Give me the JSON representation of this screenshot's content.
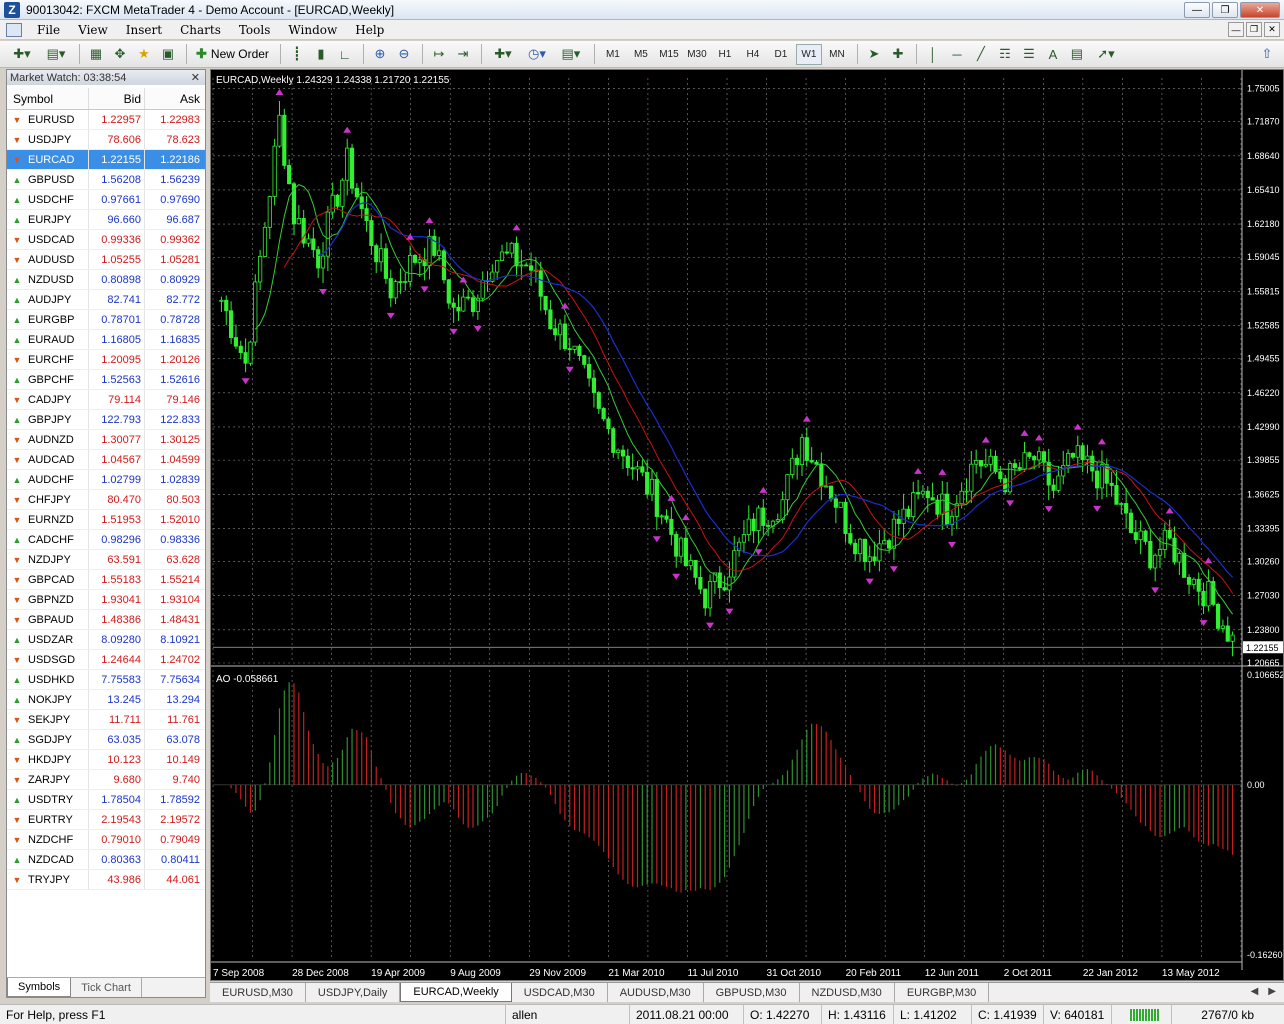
{
  "window": {
    "title": "90013042: FXCM MetaTrader 4 - Demo Account - [EURCAD,Weekly]",
    "app_icon": "Z"
  },
  "menu": [
    "File",
    "View",
    "Insert",
    "Charts",
    "Tools",
    "Window",
    "Help"
  ],
  "toolbar": {
    "new_order_label": "New Order",
    "timeframes": [
      "M1",
      "M5",
      "M15",
      "M30",
      "H1",
      "H4",
      "D1",
      "W1",
      "MN"
    ],
    "active_timeframe": "W1"
  },
  "market_watch": {
    "title": "Market Watch: 03:38:54",
    "columns": [
      "Symbol",
      "Bid",
      "Ask"
    ],
    "selected": "EURCAD",
    "rows": [
      {
        "symbol": "EURUSD",
        "bid": "1.22957",
        "ask": "1.22983",
        "dir": "down"
      },
      {
        "symbol": "USDJPY",
        "bid": "78.606",
        "ask": "78.623",
        "dir": "down"
      },
      {
        "symbol": "EURCAD",
        "bid": "1.22155",
        "ask": "1.22186",
        "dir": "down"
      },
      {
        "symbol": "GBPUSD",
        "bid": "1.56208",
        "ask": "1.56239",
        "dir": "up"
      },
      {
        "symbol": "USDCHF",
        "bid": "0.97661",
        "ask": "0.97690",
        "dir": "up"
      },
      {
        "symbol": "EURJPY",
        "bid": "96.660",
        "ask": "96.687",
        "dir": "up"
      },
      {
        "symbol": "USDCAD",
        "bid": "0.99336",
        "ask": "0.99362",
        "dir": "down"
      },
      {
        "symbol": "AUDUSD",
        "bid": "1.05255",
        "ask": "1.05281",
        "dir": "down"
      },
      {
        "symbol": "NZDUSD",
        "bid": "0.80898",
        "ask": "0.80929",
        "dir": "up"
      },
      {
        "symbol": "AUDJPY",
        "bid": "82.741",
        "ask": "82.772",
        "dir": "up"
      },
      {
        "symbol": "EURGBP",
        "bid": "0.78701",
        "ask": "0.78728",
        "dir": "up"
      },
      {
        "symbol": "EURAUD",
        "bid": "1.16805",
        "ask": "1.16835",
        "dir": "up"
      },
      {
        "symbol": "EURCHF",
        "bid": "1.20095",
        "ask": "1.20126",
        "dir": "down"
      },
      {
        "symbol": "GBPCHF",
        "bid": "1.52563",
        "ask": "1.52616",
        "dir": "up"
      },
      {
        "symbol": "CADJPY",
        "bid": "79.114",
        "ask": "79.146",
        "dir": "down"
      },
      {
        "symbol": "GBPJPY",
        "bid": "122.793",
        "ask": "122.833",
        "dir": "up"
      },
      {
        "symbol": "AUDNZD",
        "bid": "1.30077",
        "ask": "1.30125",
        "dir": "down"
      },
      {
        "symbol": "AUDCAD",
        "bid": "1.04567",
        "ask": "1.04599",
        "dir": "down"
      },
      {
        "symbol": "AUDCHF",
        "bid": "1.02799",
        "ask": "1.02839",
        "dir": "up"
      },
      {
        "symbol": "CHFJPY",
        "bid": "80.470",
        "ask": "80.503",
        "dir": "down"
      },
      {
        "symbol": "EURNZD",
        "bid": "1.51953",
        "ask": "1.52010",
        "dir": "down"
      },
      {
        "symbol": "CADCHF",
        "bid": "0.98296",
        "ask": "0.98336",
        "dir": "up"
      },
      {
        "symbol": "NZDJPY",
        "bid": "63.591",
        "ask": "63.628",
        "dir": "down"
      },
      {
        "symbol": "GBPCAD",
        "bid": "1.55183",
        "ask": "1.55214",
        "dir": "down"
      },
      {
        "symbol": "GBPNZD",
        "bid": "1.93041",
        "ask": "1.93104",
        "dir": "down"
      },
      {
        "symbol": "GBPAUD",
        "bid": "1.48386",
        "ask": "1.48431",
        "dir": "down"
      },
      {
        "symbol": "USDZAR",
        "bid": "8.09280",
        "ask": "8.10921",
        "dir": "up"
      },
      {
        "symbol": "USDSGD",
        "bid": "1.24644",
        "ask": "1.24702",
        "dir": "down"
      },
      {
        "symbol": "USDHKD",
        "bid": "7.75583",
        "ask": "7.75634",
        "dir": "up"
      },
      {
        "symbol": "NOKJPY",
        "bid": "13.245",
        "ask": "13.294",
        "dir": "up"
      },
      {
        "symbol": "SEKJPY",
        "bid": "11.711",
        "ask": "11.761",
        "dir": "down"
      },
      {
        "symbol": "SGDJPY",
        "bid": "63.035",
        "ask": "63.078",
        "dir": "up"
      },
      {
        "symbol": "HKDJPY",
        "bid": "10.123",
        "ask": "10.149",
        "dir": "down"
      },
      {
        "symbol": "ZARJPY",
        "bid": "9.680",
        "ask": "9.740",
        "dir": "down"
      },
      {
        "symbol": "USDTRY",
        "bid": "1.78504",
        "ask": "1.78592",
        "dir": "up"
      },
      {
        "symbol": "EURTRY",
        "bid": "2.19543",
        "ask": "2.19572",
        "dir": "down"
      },
      {
        "symbol": "NZDCHF",
        "bid": "0.79010",
        "ask": "0.79049",
        "dir": "down"
      },
      {
        "symbol": "NZDCAD",
        "bid": "0.80363",
        "ask": "0.80411",
        "dir": "up"
      },
      {
        "symbol": "TRYJPY",
        "bid": "43.986",
        "ask": "44.061",
        "dir": "down"
      }
    ],
    "tabs": [
      "Symbols",
      "Tick Chart"
    ],
    "active_tab": "Symbols"
  },
  "chart_tabs": [
    "EURUSD,M30",
    "USDJPY,Daily",
    "EURCAD,Weekly",
    "USDCAD,M30",
    "AUDUSD,M30",
    "GBPUSD,M30",
    "NZDUSD,M30",
    "EURGBP,M30"
  ],
  "active_chart_tab": "EURCAD,Weekly",
  "status": {
    "help": "For Help, press F1",
    "profile": "allen",
    "datetime": "2011.08.21 00:00",
    "open": "O: 1.42270",
    "high": "H: 1.43116",
    "low": "L: 1.41202",
    "close": "C: 1.41939",
    "volume": "V: 640181",
    "traffic": "2767/0 kb"
  },
  "colors": {
    "bull": "#33ee33",
    "bear": "#33ee33",
    "ma_fast": "#33cc33",
    "ma_mid": "#cc1111",
    "ma_slow": "#1a2ecc",
    "fractal": "#cc33cc",
    "ao_up": "#2f8f2f",
    "ao_down": "#c42020",
    "grid": "#8a8a8a"
  },
  "chart_data": {
    "type": "candlestick",
    "symbol": "EURCAD",
    "timeframe": "Weekly",
    "header": "EURCAD,Weekly  1.24329 1.24338 1.21720 1.22155",
    "last_price": "1.22155",
    "price_labels": [
      "1.75005",
      "1.71870",
      "1.68640",
      "1.65410",
      "1.62180",
      "1.59045",
      "1.55815",
      "1.52585",
      "1.49455",
      "1.46220",
      "1.42990",
      "1.39855",
      "1.36625",
      "1.33395",
      "1.30260",
      "1.27030",
      "1.23800",
      "1.20665"
    ],
    "y_range": [
      1.20665,
      1.76
    ],
    "time_labels": [
      "7 Sep 2008",
      "28 Dec 2008",
      "19 Apr 2009",
      "9 Aug 2009",
      "29 Nov 2009",
      "21 Mar 2010",
      "11 Jul 2010",
      "31 Oct 2010",
      "20 Feb 2011",
      "12 Jun 2011",
      "2 Oct 2011",
      "22 Jan 2012",
      "13 May 2012"
    ],
    "bar_count": 210,
    "anchor_closes": [
      [
        0,
        1.55
      ],
      [
        5,
        1.49
      ],
      [
        12,
        1.72
      ],
      [
        15,
        1.63
      ],
      [
        20,
        1.59
      ],
      [
        26,
        1.68
      ],
      [
        30,
        1.62
      ],
      [
        35,
        1.56
      ],
      [
        40,
        1.59
      ],
      [
        44,
        1.6
      ],
      [
        48,
        1.54
      ],
      [
        52,
        1.55
      ],
      [
        56,
        1.59
      ],
      [
        60,
        1.59
      ],
      [
        64,
        1.58
      ],
      [
        68,
        1.53
      ],
      [
        72,
        1.51
      ],
      [
        78,
        1.44
      ],
      [
        84,
        1.4
      ],
      [
        90,
        1.36
      ],
      [
        96,
        1.3
      ],
      [
        100,
        1.27
      ],
      [
        104,
        1.29
      ],
      [
        110,
        1.34
      ],
      [
        116,
        1.36
      ],
      [
        120,
        1.42
      ],
      [
        126,
        1.37
      ],
      [
        130,
        1.33
      ],
      [
        134,
        1.31
      ],
      [
        140,
        1.34
      ],
      [
        146,
        1.37
      ],
      [
        150,
        1.35
      ],
      [
        156,
        1.4
      ],
      [
        162,
        1.38
      ],
      [
        168,
        1.4
      ],
      [
        172,
        1.37
      ],
      [
        176,
        1.4
      ],
      [
        180,
        1.39
      ],
      [
        184,
        1.37
      ],
      [
        188,
        1.33
      ],
      [
        192,
        1.31
      ],
      [
        196,
        1.32
      ],
      [
        200,
        1.29
      ],
      [
        204,
        1.27
      ],
      [
        210,
        1.22
      ]
    ],
    "indicator": {
      "name": "AO",
      "header": "AO -0.058661",
      "y_labels": [
        "0.106652",
        "0.00",
        "-0.162606"
      ],
      "y_range": [
        -0.162606,
        0.106652
      ]
    }
  }
}
